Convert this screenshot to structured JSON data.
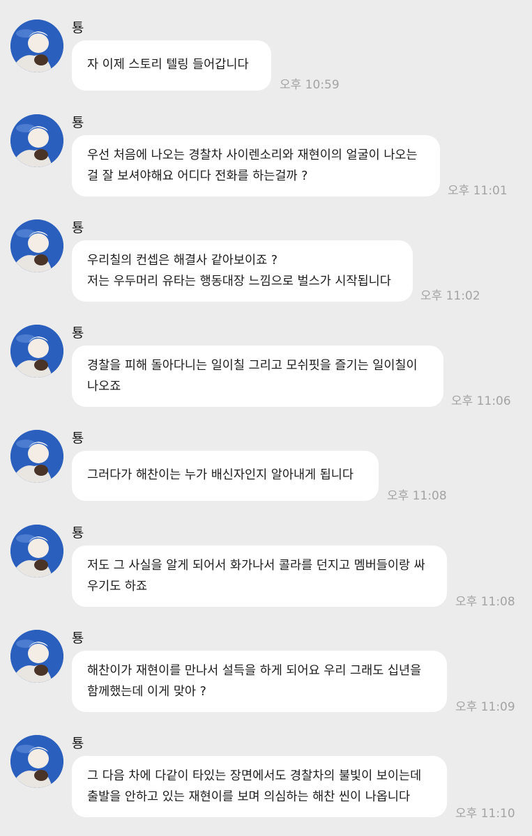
{
  "chat": {
    "messages": [
      {
        "sender": "툥",
        "lines": [
          "자 이제 스토리 텔링 들어갑니다"
        ],
        "time": "오후 10:59"
      },
      {
        "sender": "툥",
        "lines": [
          "우선 처음에 나오는 경찰차 사이렌소리와 재현이의 얼굴이 나오는",
          "걸 잘 보셔야해요 어디다 전화를 하는걸까 ?"
        ],
        "time": "오후 11:01"
      },
      {
        "sender": "툥",
        "lines": [
          "우리칠의 컨셉은 해결사 같아보이죠 ?",
          "저는 우두머리 유타는 행동대장 느낌으로 벌스가 시작됩니다"
        ],
        "time": "오후 11:02"
      },
      {
        "sender": "툥",
        "lines": [
          "경찰을 피해 돌아다니는 일이칠 그리고 모쉬핏을 즐기는 일이칠이",
          "나오죠"
        ],
        "time": "오후 11:06"
      },
      {
        "sender": "툥",
        "lines": [
          "그러다가 해찬이는 누가 배신자인지 알아내게 됩니다"
        ],
        "time": "오후 11:08"
      },
      {
        "sender": "툥",
        "lines": [
          "저도 그 사실을 알게 되어서 화가나서 콜라를 던지고 멤버들이랑 싸",
          "우기도 하죠"
        ],
        "time": "오후 11:08"
      },
      {
        "sender": "툥",
        "lines": [
          "해찬이가 재현이를 만나서 설득을 하게 되어요 우리 그래도 십년을",
          "함께했는데 이게 맞아 ?"
        ],
        "time": "오후 11:09"
      },
      {
        "sender": "툥",
        "lines": [
          "그 다음 차에 다같이 타있는 장면에서도 경찰차의 불빛이 보이는데",
          "출발을 안하고 있는 재현이를 보며 의심하는 해찬 씬이 나옵니다"
        ],
        "time": "오후 11:10"
      }
    ]
  }
}
